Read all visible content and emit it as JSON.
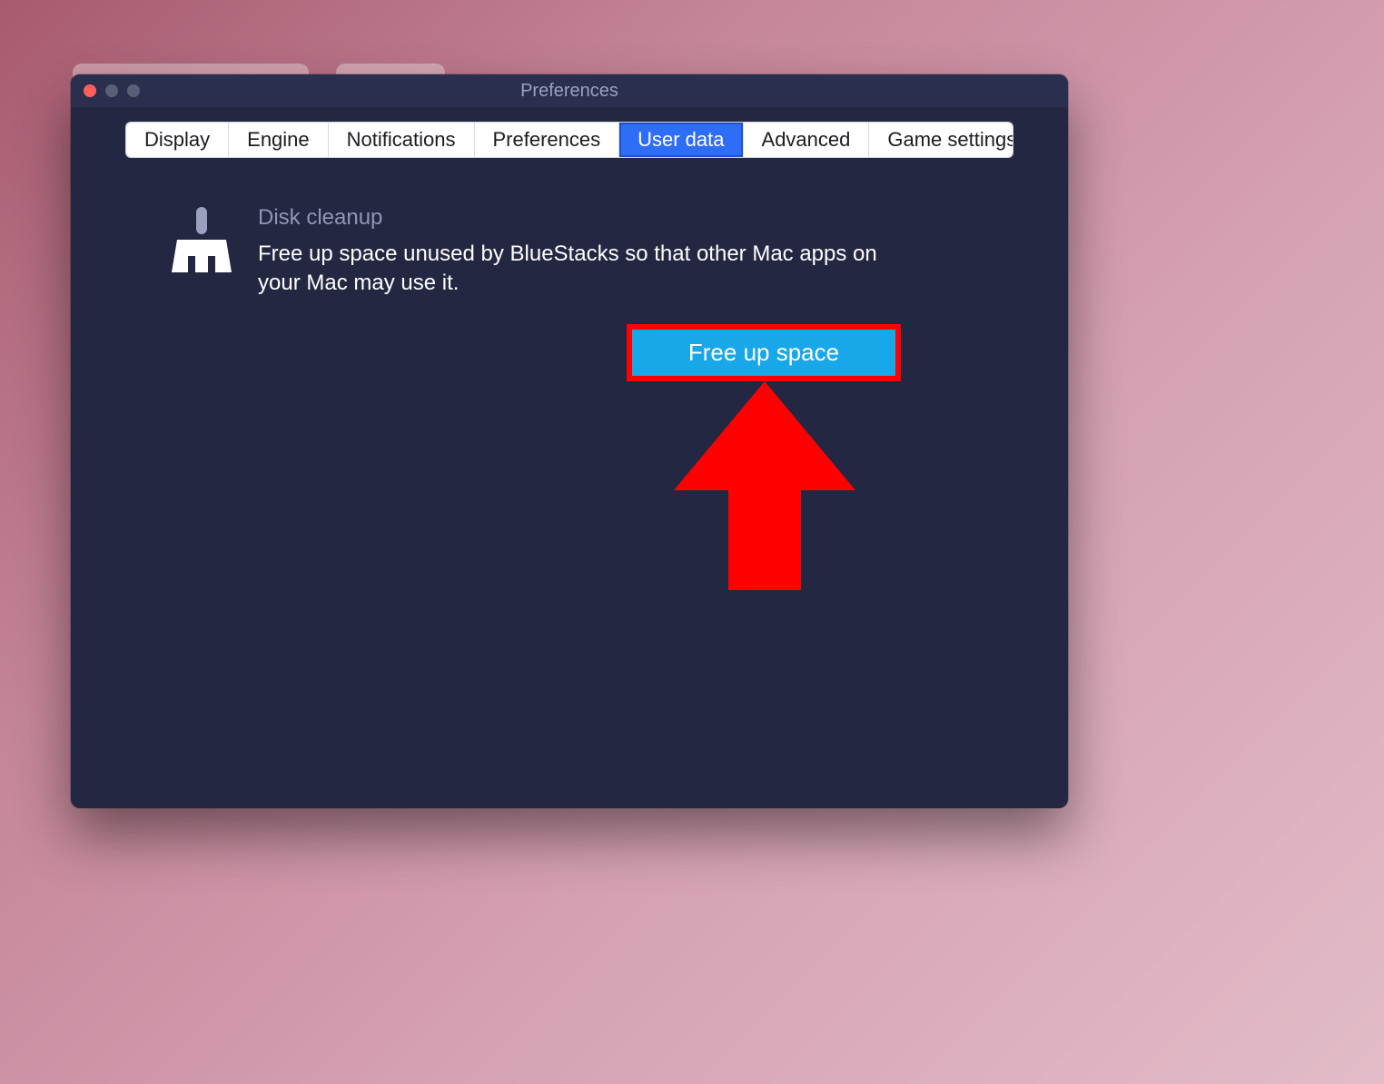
{
  "window": {
    "title": "Preferences"
  },
  "tabs": {
    "display": "Display",
    "engine": "Engine",
    "notifications": "Notifications",
    "preferences": "Preferences",
    "user_data": "User data",
    "advanced": "Advanced",
    "game_settings": "Game settings"
  },
  "section": {
    "title": "Disk cleanup",
    "description": "Free up space unused by BlueStacks so that other Mac apps on your Mac may use it."
  },
  "action": {
    "free_up_space": "Free up space"
  },
  "annotation": {
    "highlight_color": "#ff0000",
    "arrow_color": "#ff0000"
  }
}
